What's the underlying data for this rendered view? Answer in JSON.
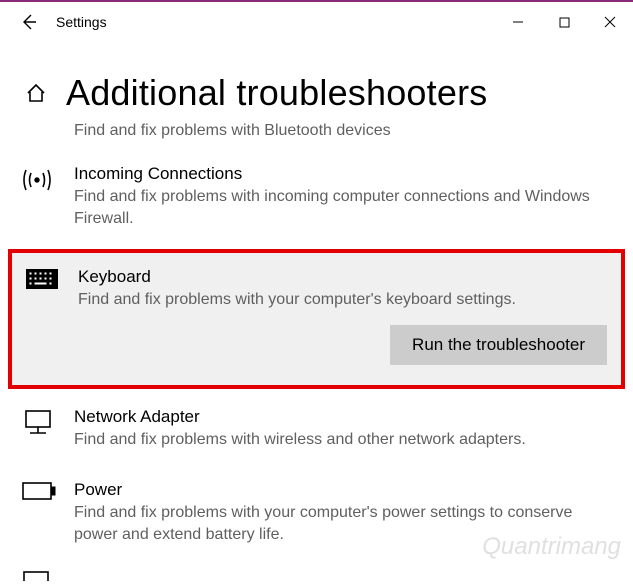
{
  "titlebar": {
    "title": "Settings"
  },
  "page_title": "Additional troubleshooters",
  "truncated_top": "Find and fix problems with Bluetooth devices",
  "items": {
    "incoming": {
      "label": "Incoming Connections",
      "desc": "Find and fix problems with incoming computer connections and Windows Firewall."
    },
    "keyboard": {
      "label": "Keyboard",
      "desc": "Find and fix problems with your computer's keyboard settings.",
      "button": "Run the troubleshooter"
    },
    "network": {
      "label": "Network Adapter",
      "desc": "Find and fix problems with wireless and other network adapters."
    },
    "power": {
      "label": "Power",
      "desc": "Find and fix problems with your computer's power settings to conserve power and extend battery life."
    }
  },
  "watermark": "Quantrimang"
}
